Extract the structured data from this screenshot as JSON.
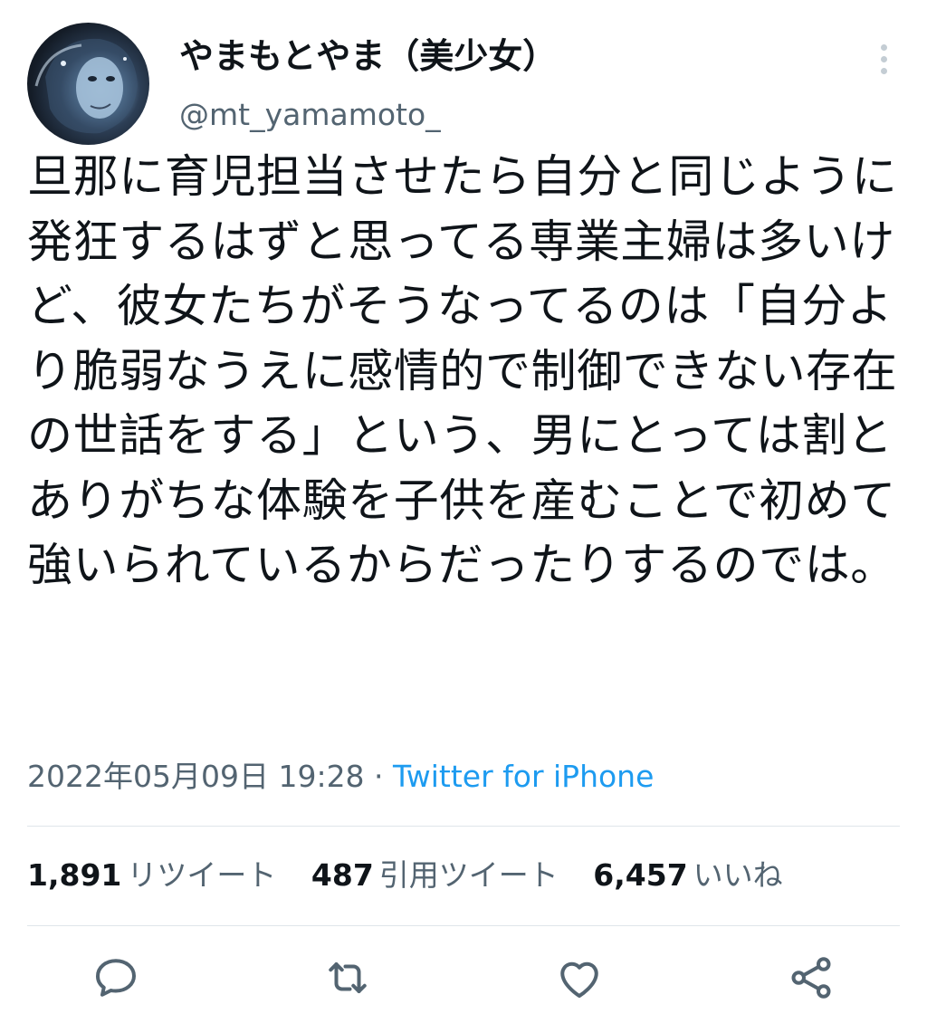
{
  "user": {
    "display_name": "やまもとやま（美少女）",
    "handle": "@mt_yamamoto_",
    "avatar_icon": "avatar-image"
  },
  "tweet": {
    "text": "旦那に育児担当させたら自分と同じように発狂するはずと思ってる専業主婦は多いけど、彼女たちがそうなってるのは「自分より脆弱なうえに感情的で制御できない存在の世話をする」という、男にとっては割とありがちな体験を子供を産むことで初めて強いられているからだったりするのでは。",
    "timestamp": "2022年05月09日 19:28",
    "separator": " · ",
    "source": "Twitter for iPhone"
  },
  "stats": {
    "retweets": {
      "count": "1,891",
      "label": "リツイート"
    },
    "quotes": {
      "count": "487",
      "label": "引用ツイート"
    },
    "likes": {
      "count": "6,457",
      "label": "いいね"
    }
  },
  "icons": [
    "more-icon",
    "reply-icon",
    "retweet-icon",
    "like-icon",
    "share-icon"
  ],
  "colors": {
    "accent": "#1d9bf0",
    "text": "#0f1419",
    "secondary": "#536471",
    "divider": "#dfe5ea"
  }
}
